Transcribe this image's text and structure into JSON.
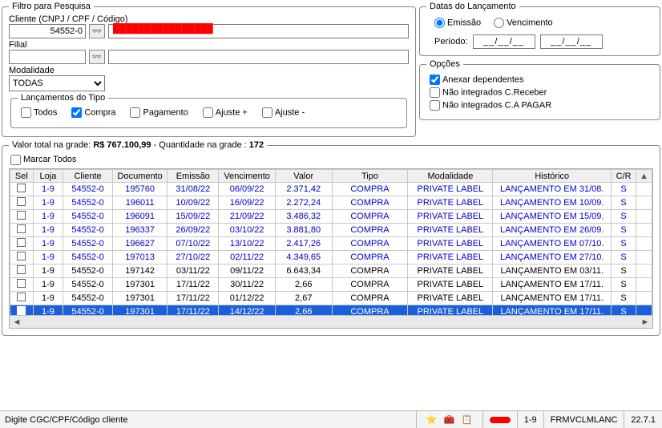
{
  "filtro": {
    "legend": "Filtro para Pesquisa",
    "cliente_label": "Cliente (CNPJ / CPF / Código)",
    "cliente_value": "54552-0",
    "cliente_name_redacted": "████████████████",
    "filial_label": "Filial",
    "filial_value": "",
    "modalidade_label": "Modalidade",
    "modalidade_value": "TODAS",
    "binoc_glyph": "🔍"
  },
  "lancamentos_tipo": {
    "legend": "Lançamentos do Tipo",
    "todos": "Todos",
    "compra": "Compra",
    "pagamento": "Pagamento",
    "ajuste_mais": "Ajuste +",
    "ajuste_menos": "Ajuste -",
    "compra_checked": true
  },
  "datas": {
    "legend": "Datas do Lançamento",
    "emissao": "Emissão",
    "vencimento": "Vencimento",
    "periodo_label": "Período:",
    "date_placeholder": "__/__/__"
  },
  "opcoes": {
    "legend": "Opções",
    "anexar": "Anexar dependentes",
    "nao_int_receber": "Não integrados C.Receber",
    "nao_int_pagar": "Não integrados C.A PAGAR"
  },
  "grid": {
    "legend_prefix": "Valor total na grade: ",
    "total_value": "R$ 767.100,99",
    "dash": "    -    ",
    "qtd_prefix": "Quantidade na grade : ",
    "qtd_value": "172",
    "marcar_todos": "Marcar Todos",
    "columns": {
      "sel": "Sel",
      "loja": "Loja",
      "cliente": "Cliente",
      "documento": "Documento",
      "emissao": "Emissão",
      "vencimento": "Vencimento",
      "valor": "Valor",
      "tipo": "Tipo",
      "modalidade": "Modalidade",
      "historico": "Histórico",
      "cr": "C/R",
      "arrow": "▲"
    },
    "rows": [
      {
        "style": "link",
        "loja": "1-9",
        "cliente": "54552-0",
        "doc": "195760",
        "emi": "31/08/22",
        "venc": "06/09/22",
        "valor": "2.371,42",
        "tipo": "COMPRA",
        "mod": "PRIVATE LABEL",
        "hist": "LANÇAMENTO EM 31/08.",
        "cr": "S"
      },
      {
        "style": "link",
        "loja": "1-9",
        "cliente": "54552-0",
        "doc": "196011",
        "emi": "10/09/22",
        "venc": "16/09/22",
        "valor": "2.272,24",
        "tipo": "COMPRA",
        "mod": "PRIVATE LABEL",
        "hist": "LANÇAMENTO EM 10/09.",
        "cr": "S"
      },
      {
        "style": "link",
        "loja": "1-9",
        "cliente": "54552-0",
        "doc": "196091",
        "emi": "15/09/22",
        "venc": "21/09/22",
        "valor": "3.486,32",
        "tipo": "COMPRA",
        "mod": "PRIVATE LABEL",
        "hist": "LANÇAMENTO EM 15/09.",
        "cr": "S"
      },
      {
        "style": "link",
        "loja": "1-9",
        "cliente": "54552-0",
        "doc": "196337",
        "emi": "26/09/22",
        "venc": "03/10/22",
        "valor": "3.881,80",
        "tipo": "COMPRA",
        "mod": "PRIVATE LABEL",
        "hist": "LANÇAMENTO EM 26/09.",
        "cr": "S"
      },
      {
        "style": "link",
        "loja": "1-9",
        "cliente": "54552-0",
        "doc": "196627",
        "emi": "07/10/22",
        "venc": "13/10/22",
        "valor": "2.417,26",
        "tipo": "COMPRA",
        "mod": "PRIVATE LABEL",
        "hist": "LANÇAMENTO EM 07/10.",
        "cr": "S"
      },
      {
        "style": "link",
        "loja": "1-9",
        "cliente": "54552-0",
        "doc": "197013",
        "emi": "27/10/22",
        "venc": "02/11/22",
        "valor": "4.349,65",
        "tipo": "COMPRA",
        "mod": "PRIVATE LABEL",
        "hist": "LANÇAMENTO EM 27/10.",
        "cr": "S"
      },
      {
        "style": "normal",
        "loja": "1-9",
        "cliente": "54552-0",
        "doc": "197142",
        "emi": "03/11/22",
        "venc": "09/11/22",
        "valor": "6.643,34",
        "tipo": "COMPRA",
        "mod": "PRIVATE LABEL",
        "hist": "LANÇAMENTO EM 03/11.",
        "cr": "S"
      },
      {
        "style": "normal",
        "loja": "1-9",
        "cliente": "54552-0",
        "doc": "197301",
        "emi": "17/11/22",
        "venc": "30/11/22",
        "valor": "2,66",
        "tipo": "COMPRA",
        "mod": "PRIVATE LABEL",
        "hist": "LANÇAMENTO EM 17/11.",
        "cr": "S"
      },
      {
        "style": "normal",
        "loja": "1-9",
        "cliente": "54552-0",
        "doc": "197301",
        "emi": "17/11/22",
        "venc": "01/12/22",
        "valor": "2,67",
        "tipo": "COMPRA",
        "mod": "PRIVATE LABEL",
        "hist": "LANÇAMENTO EM 17/11.",
        "cr": "S"
      },
      {
        "style": "selected",
        "loja": "1-9",
        "cliente": "54552-0",
        "doc": "197301",
        "emi": "17/11/22",
        "venc": "14/12/22",
        "valor": "2,66",
        "tipo": "COMPRA",
        "mod": "PRIVATE LABEL",
        "hist": "LANÇAMENTO EM 17/11.",
        "cr": "S"
      }
    ]
  },
  "statusbar": {
    "hint": "Digite CGC/CPF/Código cliente",
    "loja": "1-9",
    "form": "FRMVCLMLANC",
    "version": "22.7.1",
    "star": "⭐",
    "util": "🧰",
    "clip": "📋"
  }
}
